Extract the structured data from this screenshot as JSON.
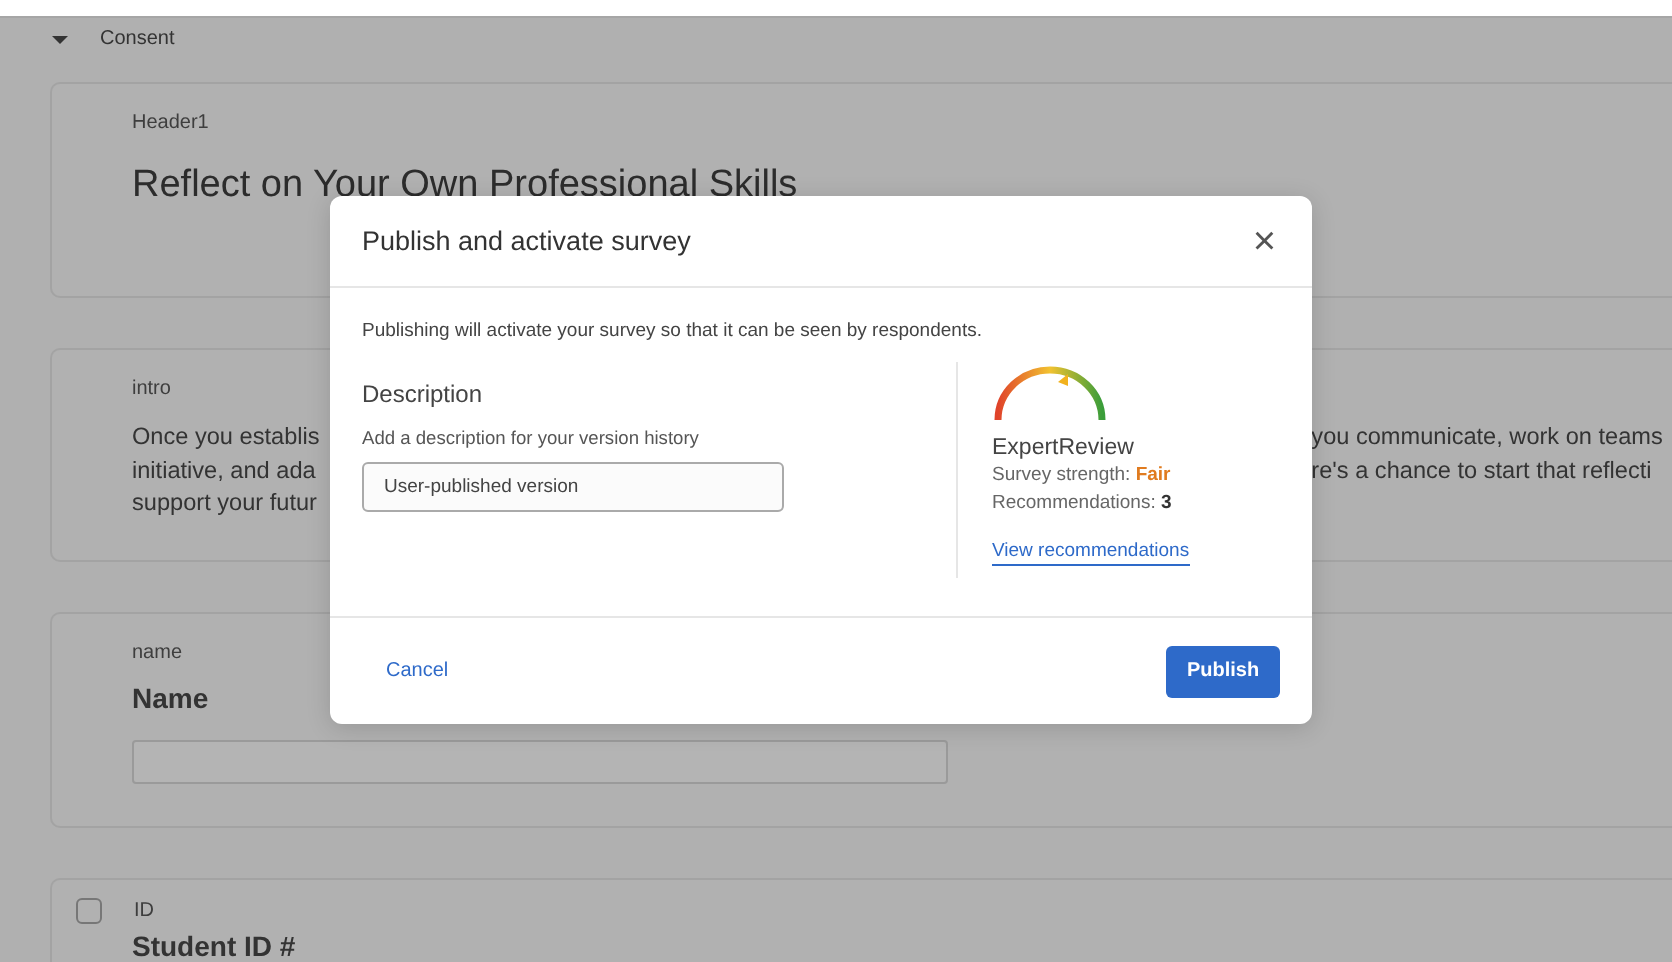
{
  "section": {
    "title": "Consent",
    "expanded": true
  },
  "blocks": [
    {
      "kind": "header",
      "tag": "Header1",
      "title": "Reflect on Your Own Professional Skills"
    },
    {
      "kind": "text",
      "tag": "intro",
      "left_lines": [
        "Once you establis",
        "initiative, and ada",
        "support your futur"
      ],
      "right_lines": [
        "you communicate, work on teams",
        "re's a chance to start that reflecti"
      ]
    },
    {
      "kind": "entry",
      "tag": "name",
      "title": "Name"
    },
    {
      "kind": "check",
      "tag": "ID",
      "title": "Student ID #",
      "checked": false
    }
  ],
  "dialog": {
    "title": "Publish and activate survey",
    "close": "×",
    "message": "Publishing will activate your survey so that it can be seen by respondents.",
    "description": {
      "label": "Description",
      "hint": "Add a description for your version history",
      "value": "User-published version"
    },
    "review": {
      "name": "ExpertReview",
      "strength_label": "Survey strength:",
      "strength": "Fair",
      "recommendations_label": "Recommendations:",
      "recommendations": "3",
      "link": "View recommendations"
    },
    "buttons": {
      "cancel": "Cancel",
      "publish": "Publish"
    }
  }
}
